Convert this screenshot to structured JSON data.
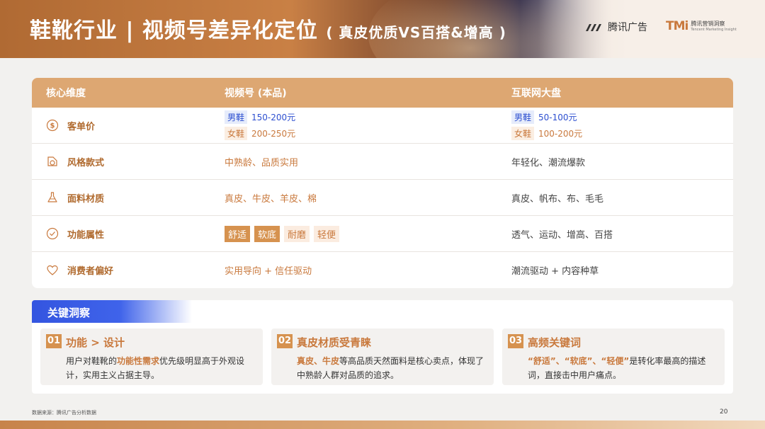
{
  "header": {
    "title_main": "鞋靴行业 | 视频号差异化定位",
    "title_sub": "( 真皮优质VS百搭&增高 )",
    "logo_tencent_ads": "腾讯广告",
    "logo_tmi_mark": "TMi",
    "logo_tmi_cn": "腾讯营销洞察",
    "logo_tmi_en": "Tencent Marketing Insight"
  },
  "table": {
    "headers": [
      "核心维度",
      "视频号 (本品)",
      "互联网大盘"
    ],
    "rows": [
      {
        "dimension": "客单价",
        "icon": "dollar-circle-icon",
        "channels_pairs": [
          [
            "男鞋",
            "150-200元"
          ],
          [
            "女鞋",
            "200-250元"
          ]
        ],
        "market_pairs": [
          [
            "男鞋",
            "50-100元"
          ],
          [
            "女鞋",
            "100-200元"
          ]
        ]
      },
      {
        "dimension": "风格款式",
        "icon": "style-icon",
        "channels": "中熟龄、品质实用",
        "market": "年轻化、潮流爆款"
      },
      {
        "dimension": "面料材质",
        "icon": "flask-icon",
        "channels": "真皮、牛皮、羊皮、棉",
        "market": "真皮、帆布、布、毛毛"
      },
      {
        "dimension": "功能属性",
        "icon": "check-circle-icon",
        "channels_chips": [
          "舒适",
          "软底",
          "耐磨",
          "轻便"
        ],
        "market": "透气、运动、增高、百搭"
      },
      {
        "dimension": "消费者偏好",
        "icon": "heart-icon",
        "channels": "实用导向 + 信任驱动",
        "market": "潮流驱动 + 内容种草"
      }
    ]
  },
  "insights": {
    "heading": "关键洞察",
    "cards": [
      {
        "num": "01",
        "title": "功能 > 设计",
        "body_1": "用户对鞋靴的",
        "body_hl": "功能性需求",
        "body_2": "优先级明显高于外观设计，实用主义占据主导。"
      },
      {
        "num": "02",
        "title": "真皮材质受青睐",
        "body_hl": "真皮、牛皮",
        "body_2": "等高品质天然面料是核心卖点，体现了中熟龄人群对品质的追求。"
      },
      {
        "num": "03",
        "title": "高频关键词",
        "body_hl": "“舒适”、“软底”、“轻便”",
        "body_2": "是转化率最高的描述词，直接击中用户痛点。"
      }
    ]
  },
  "footer": {
    "source": "数据来源：腾讯广告分析数据",
    "page": "20"
  },
  "colors": {
    "accent": "#c9793d",
    "header_bg": "#dda772",
    "blue": "#3455e0"
  }
}
